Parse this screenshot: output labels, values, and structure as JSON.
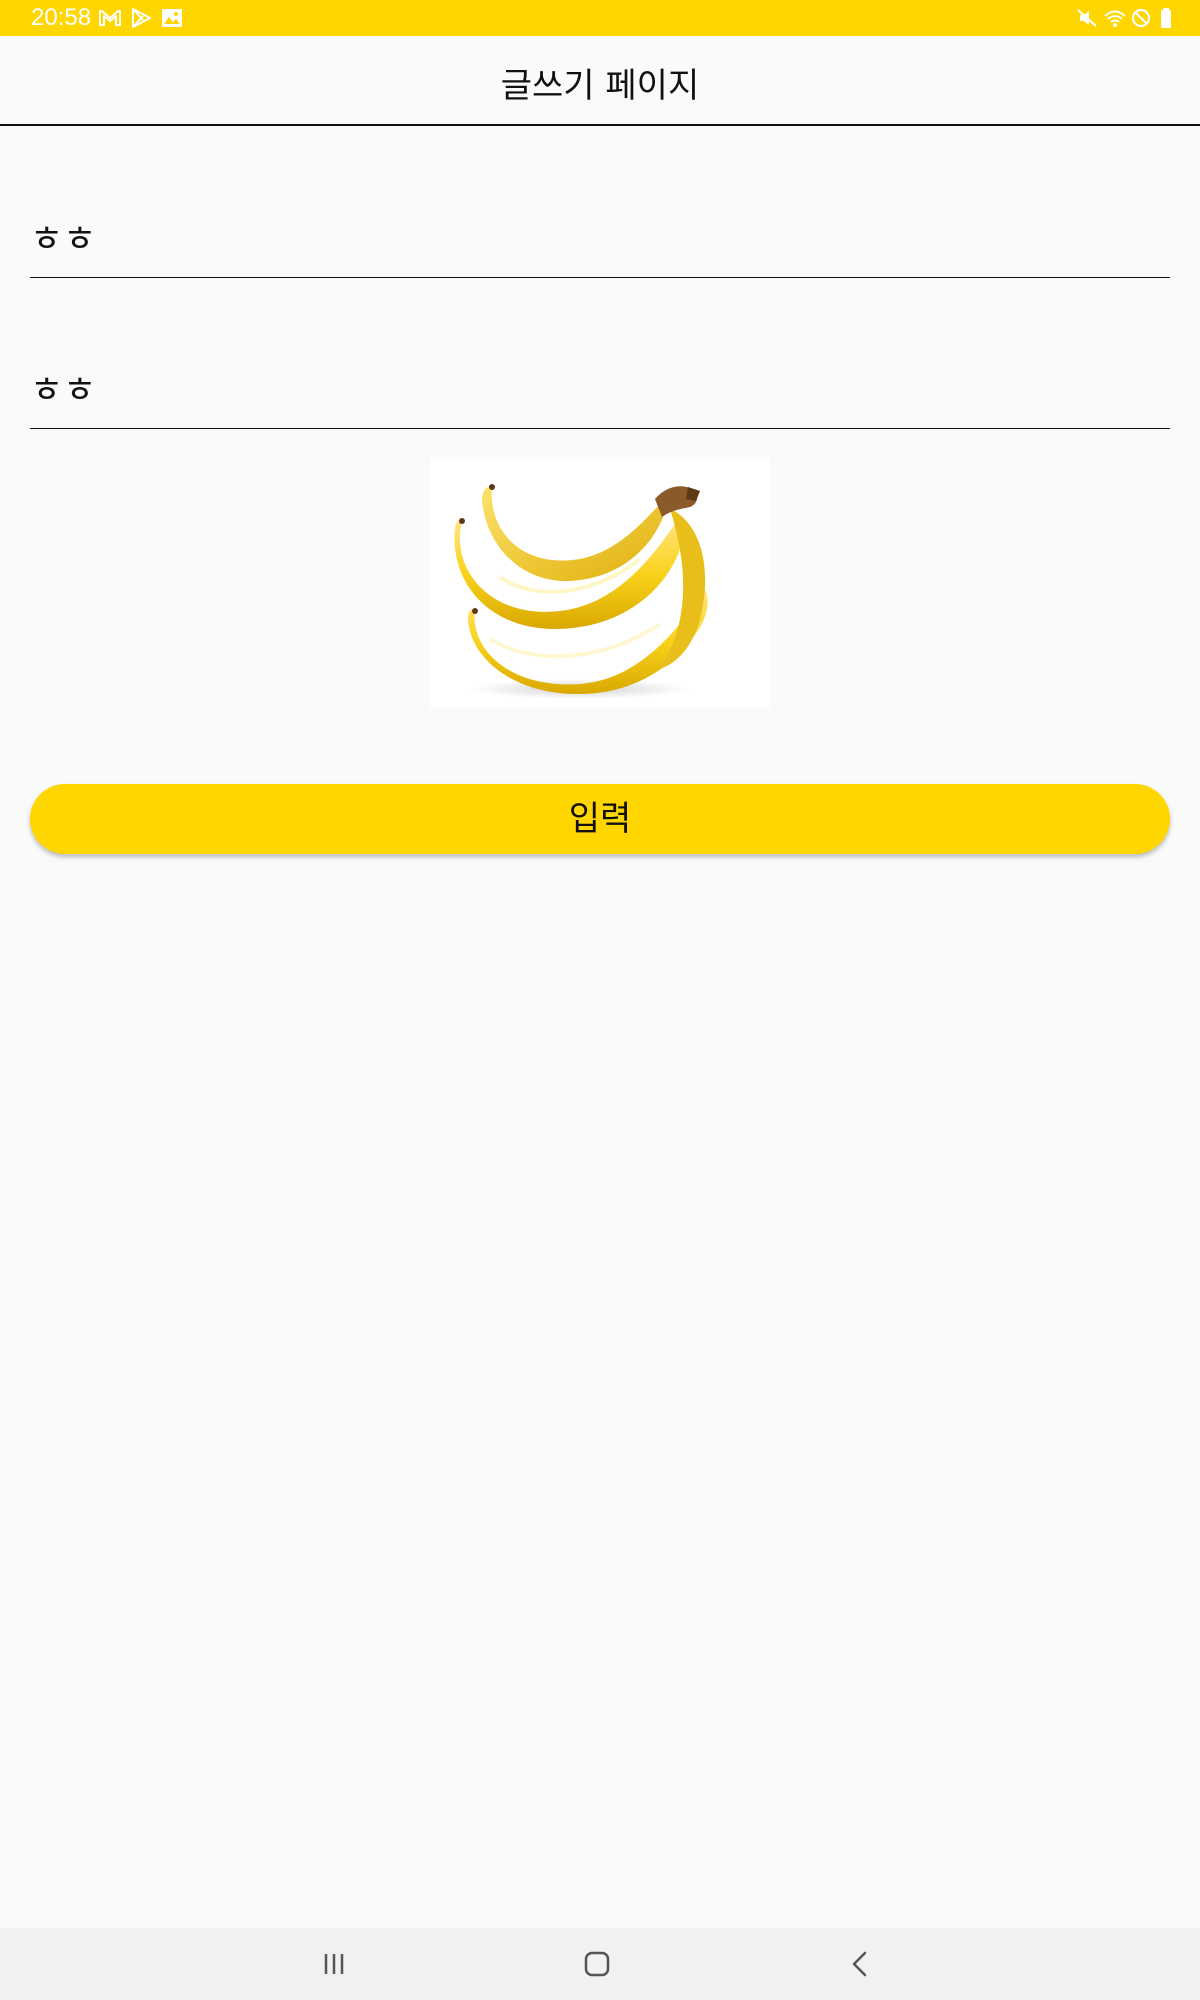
{
  "status_bar": {
    "time": "20:58",
    "left_icons": [
      "gmail-icon",
      "play-store-icon",
      "gallery-icon"
    ],
    "right_icons": [
      "mute-icon",
      "wifi-icon",
      "do-not-disturb-icon",
      "battery-icon"
    ],
    "color": "#ffd600"
  },
  "app_bar": {
    "title": "글쓰기 페이지"
  },
  "form": {
    "title_field_value": "ㅎㅎ",
    "content_field_value": "ㅎㅎ",
    "image": "banana-image",
    "submit_label": "입력"
  },
  "nav_bar": {
    "buttons": [
      "recent-apps-icon",
      "home-icon",
      "back-icon"
    ]
  },
  "colors": {
    "accent": "#ffd600",
    "background": "#fafafa",
    "text": "#111111"
  }
}
